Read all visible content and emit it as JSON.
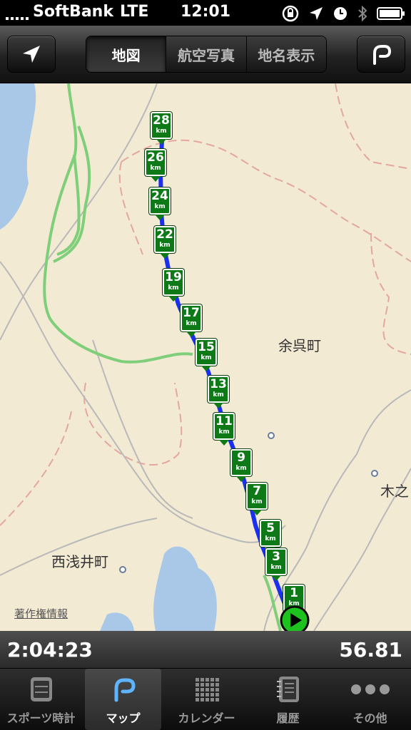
{
  "status_bar": {
    "carrier": "SoftBank",
    "network": "LTE",
    "time": "12:01"
  },
  "navbar": {
    "location_button": "location-arrow-icon",
    "segments": [
      "地図",
      "航空写真",
      "地名表示"
    ],
    "selected_segment": "地図",
    "route_button": "route-icon"
  },
  "map": {
    "place_labels": [
      "余呉町",
      "西浅井町",
      "木之"
    ],
    "attribution": "著作権情報",
    "km_markers": [
      "28",
      "26",
      "24",
      "22",
      "19",
      "17",
      "15",
      "13",
      "11",
      "9",
      "7",
      "5",
      "3",
      "1"
    ],
    "km_unit": "km",
    "route_color": "#1a2ff0",
    "marker_color": "#0d7a17",
    "start_icon": "play-icon"
  },
  "info": {
    "elapsed_time": "2:04:23",
    "distance": "56.81"
  },
  "tabs": [
    {
      "label": "スポーツ時計",
      "icon": "stopwatch-icon"
    },
    {
      "label": "マップ",
      "icon": "route-icon"
    },
    {
      "label": "カレンダー",
      "icon": "calendar-icon"
    },
    {
      "label": "履歴",
      "icon": "notebook-icon"
    },
    {
      "label": "その他",
      "icon": "more-icon"
    }
  ],
  "selected_tab": "マップ"
}
